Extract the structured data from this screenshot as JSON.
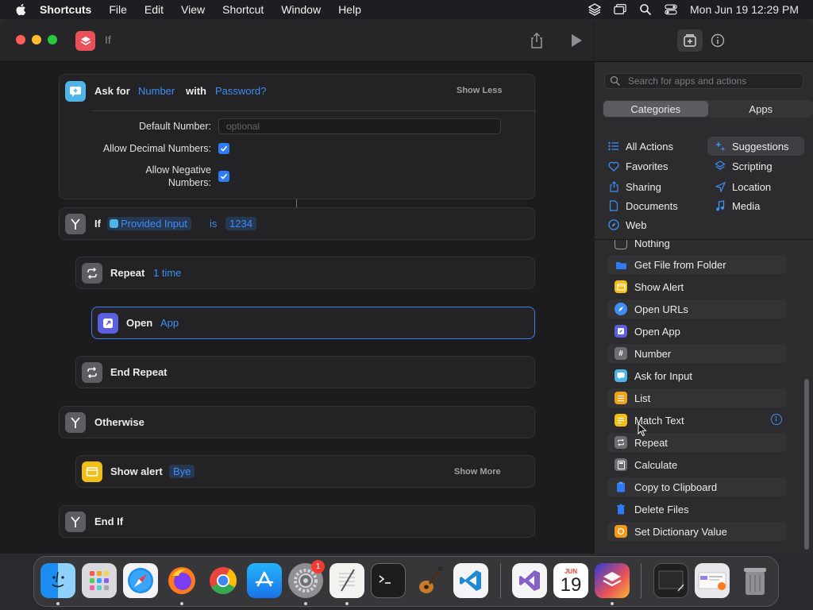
{
  "menubar": {
    "app_name": "Shortcuts",
    "menus": [
      "File",
      "Edit",
      "View",
      "Shortcut",
      "Window",
      "Help"
    ],
    "clock": "Mon Jun 19  12:29 PM"
  },
  "window": {
    "title": "If"
  },
  "editor": {
    "ask_card": {
      "verb": "Ask for",
      "type_token": "Number",
      "with": "with",
      "password_token": "Password?",
      "toggle": "Show Less",
      "default_number_label": "Default Number:",
      "default_number_placeholder": "optional",
      "allow_decimal_label": "Allow Decimal Numbers:",
      "allow_negative_label_1": "Allow Negative",
      "allow_negative_label_2": "Numbers:"
    },
    "if_card": {
      "label": "If",
      "input_token": "Provided Input",
      "is": "is",
      "value_token": "1234"
    },
    "repeat_card": {
      "label": "Repeat",
      "count_token": "1 time"
    },
    "open_card": {
      "label": "Open",
      "app_token": "App"
    },
    "end_repeat_card": {
      "label": "End Repeat"
    },
    "otherwise_card": {
      "label": "Otherwise"
    },
    "show_alert_card": {
      "label": "Show alert",
      "text_token": "Bye",
      "toggle": "Show More"
    },
    "end_if_card": {
      "label": "End If"
    }
  },
  "sidebar": {
    "search_placeholder": "Search for apps and actions",
    "segments": {
      "categories": "Categories",
      "apps": "Apps"
    },
    "categories_left": [
      "All Actions",
      "Favorites",
      "Sharing",
      "Documents",
      "Web"
    ],
    "categories_right": [
      "Suggestions",
      "Scripting",
      "Location",
      "Media"
    ],
    "selected_category": "Suggestions",
    "actions": [
      "Nothing",
      "Get File from Folder",
      "Show Alert",
      "Open URLs",
      "Open App",
      "Number",
      "Ask for Input",
      "List",
      "Match Text",
      "Repeat",
      "Calculate",
      "Copy to Clipboard",
      "Delete Files",
      "Set Dictionary Value"
    ]
  },
  "dock": {
    "apps": [
      "Finder",
      "Launchpad",
      "Safari",
      "Firefox",
      "Chrome",
      "App Store",
      "System Settings",
      "TextEdit",
      "Terminal",
      "GarageBand",
      "Visual Studio Code",
      "Visual Studio",
      "Calendar",
      "Shortcuts",
      "Screenshot",
      "Finder Window",
      "Trash"
    ],
    "settings_badge": "1",
    "calendar_month": "JUN",
    "calendar_day": "19"
  },
  "colors": {
    "accent": "#3d8ef5",
    "token_bg": "#263752",
    "card_bg": "#232325",
    "shortcut_badge": "#e9515a"
  }
}
